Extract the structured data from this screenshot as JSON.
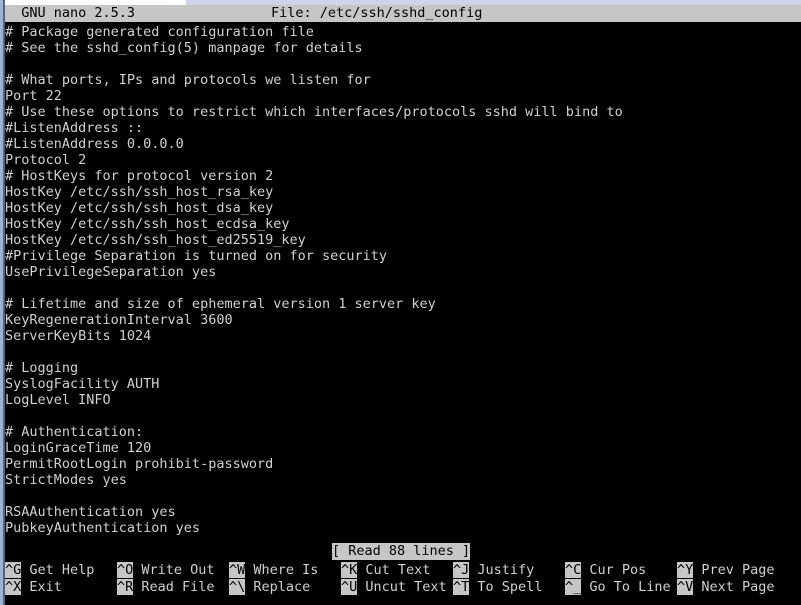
{
  "window": {
    "app": "GNU nano",
    "version": "2.5.3",
    "frame_color": "#9fb4cc",
    "frame_accent": "#3f6a9e"
  },
  "titlebar": {
    "left_text": "  GNU nano 2.5.3",
    "center_text": "File: /etc/ssh/sshd_config",
    "background": "#c6c6c6",
    "foreground": "#000000"
  },
  "editor": {
    "foreground": "#d0d0d0",
    "background": "#000000",
    "lines": [
      "# Package generated configuration file",
      "# See the sshd_config(5) manpage for details",
      "",
      "# What ports, IPs and protocols we listen for",
      "Port 22",
      "# Use these options to restrict which interfaces/protocols sshd will bind to",
      "#ListenAddress ::",
      "#ListenAddress 0.0.0.0",
      "Protocol 2",
      "# HostKeys for protocol version 2",
      "HostKey /etc/ssh/ssh_host_rsa_key",
      "HostKey /etc/ssh/ssh_host_dsa_key",
      "HostKey /etc/ssh/ssh_host_ecdsa_key",
      "HostKey /etc/ssh/ssh_host_ed25519_key",
      "#Privilege Separation is turned on for security",
      "UsePrivilegeSeparation yes",
      "",
      "# Lifetime and size of ephemeral version 1 server key",
      "KeyRegenerationInterval 3600",
      "ServerKeyBits 1024",
      "",
      "# Logging",
      "SyslogFacility AUTH",
      "LogLevel INFO",
      "",
      "# Authentication:",
      "LoginGraceTime 120",
      "PermitRootLogin prohibit-password",
      "StrictModes yes",
      "",
      "RSAAuthentication yes",
      "PubkeyAuthentication yes"
    ]
  },
  "status": {
    "message": "[ Read 88 lines ]"
  },
  "helpbar": {
    "row1": [
      {
        "key": "^G",
        "label": " Get Help",
        "col": 0
      },
      {
        "key": "^O",
        "label": " Write Out",
        "col": 14
      },
      {
        "key": "^W",
        "label": " Where Is",
        "col": 28
      },
      {
        "key": "^K",
        "label": " Cut Text",
        "col": 42
      },
      {
        "key": "^J",
        "label": " Justify",
        "col": 56
      },
      {
        "key": "^C",
        "label": " Cur Pos",
        "col": 70
      },
      {
        "key": "^Y",
        "label": " Prev Page",
        "col": 84
      }
    ],
    "row2": [
      {
        "key": "^X",
        "label": " Exit",
        "col": 0
      },
      {
        "key": "^R",
        "label": " Read File",
        "col": 14
      },
      {
        "key": "^\\",
        "label": " Replace",
        "col": 28
      },
      {
        "key": "^U",
        "label": " Uncut Text",
        "col": 42
      },
      {
        "key": "^T",
        "label": " To Spell",
        "col": 56
      },
      {
        "key": "^_",
        "label": " Go To Line",
        "col": 70
      },
      {
        "key": "^V",
        "label": " Next Page",
        "col": 84
      }
    ]
  }
}
